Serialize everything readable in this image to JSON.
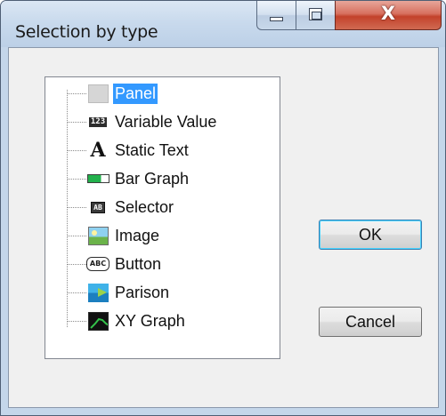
{
  "window": {
    "title": "Selection by type",
    "close_glyph": "X"
  },
  "tree": {
    "selected_index": 0,
    "items": [
      {
        "label": "Panel",
        "icon": "panel-icon"
      },
      {
        "label": "Variable Value",
        "icon": "variable-value-icon",
        "icon_text": "123"
      },
      {
        "label": "Static Text",
        "icon": "static-text-icon",
        "icon_text": "A"
      },
      {
        "label": "Bar Graph",
        "icon": "bar-graph-icon"
      },
      {
        "label": "Selector",
        "icon": "selector-icon",
        "icon_text": "AB"
      },
      {
        "label": "Image",
        "icon": "image-icon"
      },
      {
        "label": "Button",
        "icon": "button-icon",
        "icon_text": "ABC"
      },
      {
        "label": "Parison",
        "icon": "parison-icon"
      },
      {
        "label": "XY Graph",
        "icon": "xy-graph-icon"
      }
    ]
  },
  "buttons": {
    "ok_label": "OK",
    "cancel_label": "Cancel"
  },
  "colors": {
    "selection": "#3399ff",
    "close_button": "#c3422b"
  }
}
